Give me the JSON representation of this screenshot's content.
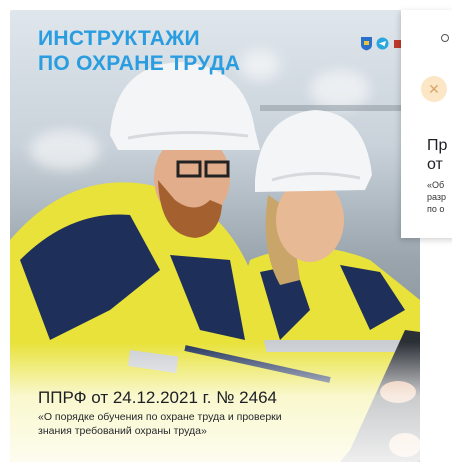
{
  "main_card": {
    "headline_line1": "ИНСТРУКТАЖИ",
    "headline_line2": "ПО ОХРАНЕ ТРУДА",
    "doc_title": "ППРФ от 24.12.2021 г. № 2464",
    "doc_subtitle_line1": "«О порядке обучения по охране труда и проверки",
    "doc_subtitle_line2": "знания требований охраны труда»",
    "logo_icons": [
      "coat-of-arms-icon",
      "telegram-icon",
      "brand-icon"
    ]
  },
  "second_card": {
    "close_icon": "close-icon",
    "title_line1": "Пр",
    "title_line2": "от",
    "subtitle_line1": "«Об",
    "subtitle_line2": "разр",
    "subtitle_line3": "по о"
  },
  "colors": {
    "headline": "#2a9de0",
    "vest_yellow": "#e8e23a",
    "vest_navy": "#1e2f5a",
    "close_bg": "#fbe6c6"
  }
}
